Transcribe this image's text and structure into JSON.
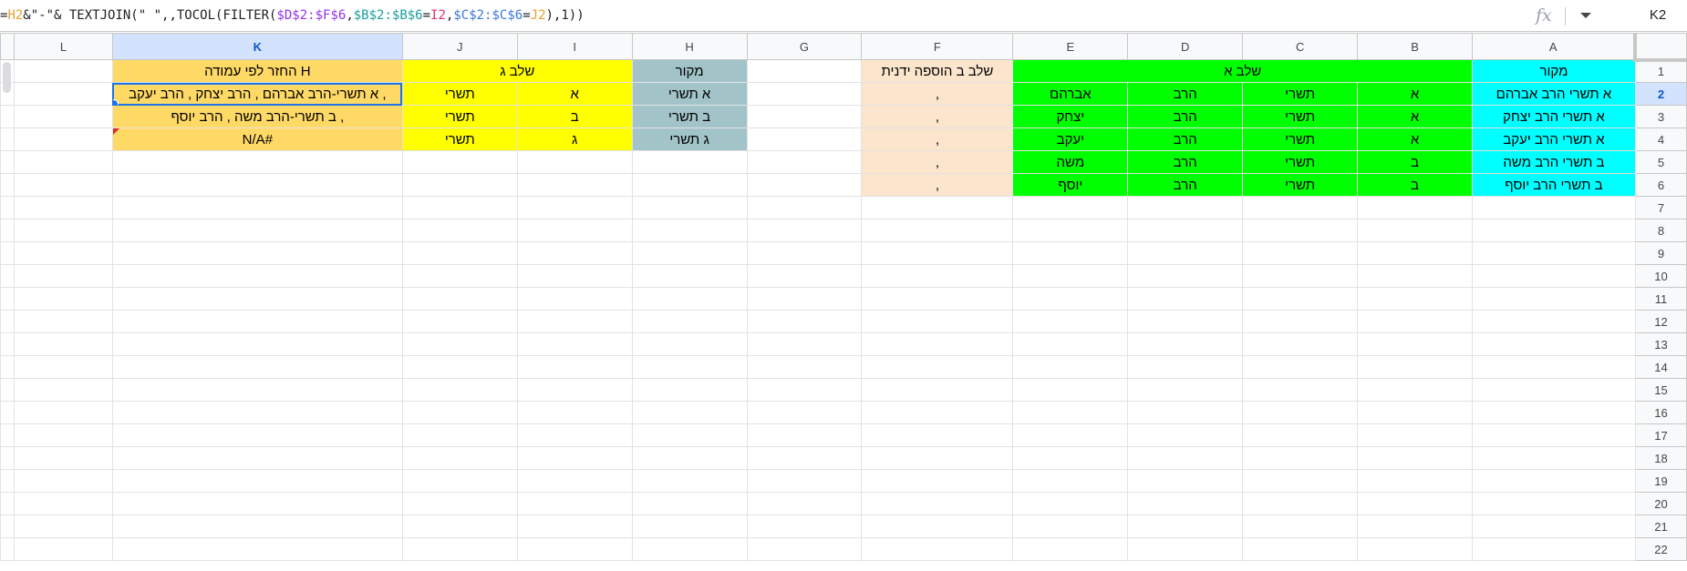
{
  "formula_bar": {
    "formula_parts": [
      "=",
      "H2",
      "&\"-\"& TEXTJOIN(\" \",,TOCOL(FILTER(",
      "$D$2:$F$6",
      ",",
      "$B$2:$B$6",
      "=",
      "I2",
      ",",
      "$C$2:$C$6",
      "=",
      "J2",
      "),1))"
    ],
    "fx_label": "fx",
    "name_box": "K2"
  },
  "columns": [
    "L",
    "K",
    "J",
    "I",
    "H",
    "G",
    "F",
    "E",
    "D",
    "C",
    "B",
    "A"
  ],
  "selected_column": "K",
  "selected_row": "2",
  "rows": [
    "1",
    "2",
    "3",
    "4",
    "5",
    "6",
    "7",
    "8",
    "9",
    "10",
    "11",
    "12",
    "13",
    "14",
    "15",
    "16",
    "17",
    "18",
    "19",
    "20",
    "21",
    "22"
  ],
  "headers": {
    "k_header": "החזר לפי עמודה H",
    "shalav_g": "שלב ג",
    "makor_h": "מקור",
    "shalav_b_manual": "שלב ב הוספה ידנית",
    "shalav_a": "שלב א",
    "makor_a": "מקור"
  },
  "k_values": [
    "א תשרי-הרב אברהם , הרב יצחק , הרב יעקב ,",
    "ב תשרי-הרב משה , הרב יוסף ,",
    "#N/A"
  ],
  "j_values": [
    "תשרי",
    "תשרי",
    "תשרי"
  ],
  "i_values": [
    "א",
    "ב",
    "ג"
  ],
  "h_values": [
    "א תשרי",
    "ב תשרי",
    "ג תשרי"
  ],
  "f_values": [
    ",",
    ",",
    ",",
    ",",
    ","
  ],
  "e_values": [
    "אברהם",
    "יצחק",
    "יעקב",
    "משה",
    "יוסף"
  ],
  "d_values": [
    "הרב",
    "הרב",
    "הרב",
    "הרב",
    "הרב"
  ],
  "c_values": [
    "תשרי",
    "תשרי",
    "תשרי",
    "תשרי",
    "תשרי"
  ],
  "b_values": [
    "א",
    "א",
    "א",
    "ב",
    "ב"
  ],
  "a_values": [
    "א תשרי הרב אברהם",
    "א תשרי הרב יצחק",
    "א תשרי הרב יעקב",
    "ב תשרי הרב משה",
    "ב תשרי הרב יוסף"
  ],
  "colors": {
    "cyan": "#00ffff",
    "green": "#00ff00",
    "peach": "#fce5cd",
    "gray_teal": "#a2c4c9",
    "yellow": "#ffff00",
    "orange": "#ffd966",
    "selection": "#1a73e8"
  }
}
